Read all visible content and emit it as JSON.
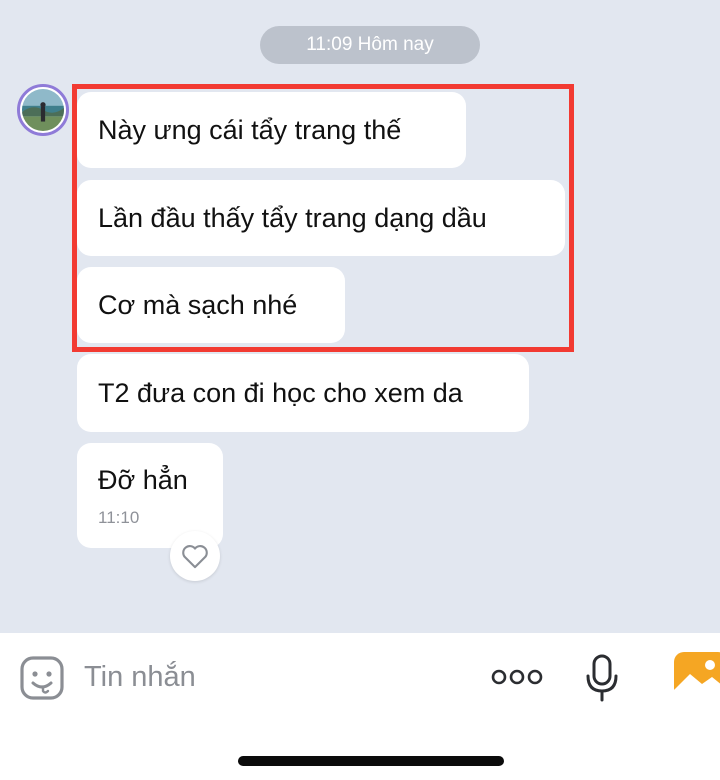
{
  "chat": {
    "timestamp_pill": "11:09 Hôm nay",
    "messages": [
      {
        "text": "Này ưng cái tẩy trang thế"
      },
      {
        "text": "Lần đầu thấy tẩy trang dạng dầu"
      },
      {
        "text": "Cơ mà sạch nhé"
      },
      {
        "text": "T2 đưa con đi học cho xem da"
      },
      {
        "text": "Đỡ hẳn",
        "time": "11:10"
      }
    ],
    "highlight_color": "#f23a32"
  },
  "composer": {
    "placeholder": "Tin nhắn",
    "icons": [
      "sticker-icon",
      "more-dots-icon",
      "microphone-icon",
      "image-icon"
    ]
  },
  "colors": {
    "background": "#e2e7f0",
    "bubble": "#ffffff",
    "accent_image": "#f5a623"
  }
}
